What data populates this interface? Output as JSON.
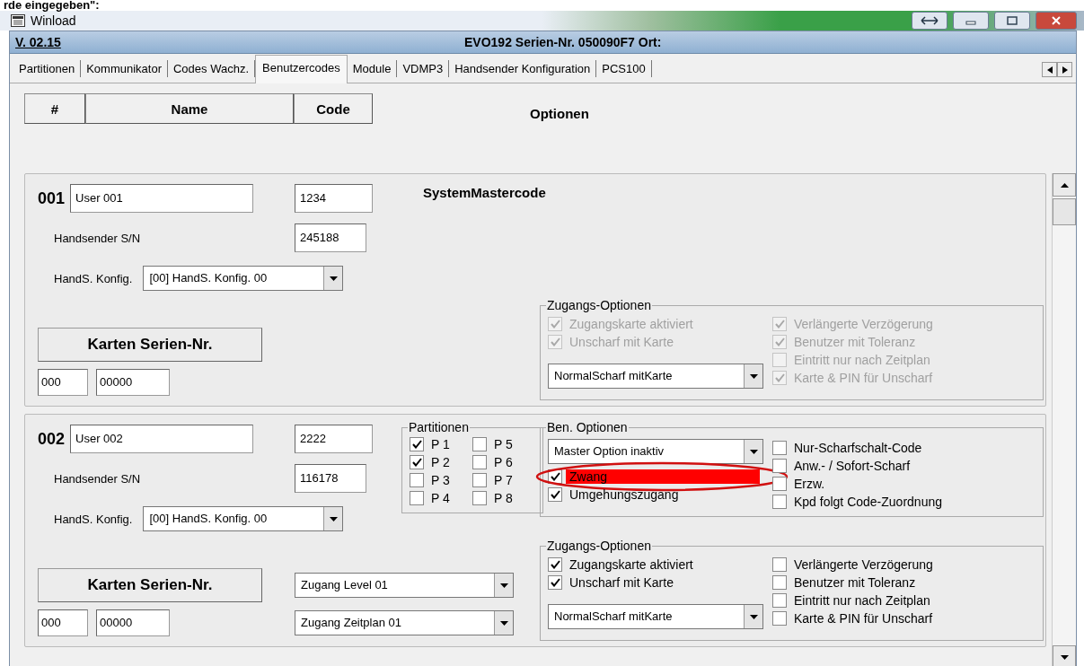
{
  "caption": "rde eingegeben\":",
  "window": {
    "title": "Winload"
  },
  "header": {
    "version": "V. 02.15",
    "info": "EVO192  Serien-Nr. 050090F7 Ort:"
  },
  "tabs": [
    {
      "label": "Partitionen",
      "selected": false
    },
    {
      "label": "Kommunikator",
      "selected": false
    },
    {
      "label": "Codes Wachz.",
      "selected": false
    },
    {
      "label": "Benutzercodes",
      "selected": true
    },
    {
      "label": "Module",
      "selected": false
    },
    {
      "label": "VDMP3",
      "selected": false
    },
    {
      "label": "Handsender Konfiguration",
      "selected": false
    },
    {
      "label": "PCS100",
      "selected": false
    }
  ],
  "columns": [
    "#",
    "Name",
    "Code",
    "Optionen"
  ],
  "users": [
    {
      "number": "001",
      "name": "User 001",
      "code": "1234",
      "master_label": "SystemMastercode",
      "handsender_label": "Handsender S/N",
      "handsender": "245188",
      "konfig_label": "HandS. Konfig.",
      "konfig": "[00] HandS. Konfig. 00",
      "card_button": "Karten Serien-Nr.",
      "card_a": "000",
      "card_b": "00000",
      "access": {
        "legend": "Zugangs-Optionen",
        "disabled": true,
        "mode": "NormalScharf mitKarte",
        "left": [
          {
            "label": "Zugangskarte aktiviert",
            "checked": true
          },
          {
            "label": "Unscharf mit Karte",
            "checked": true
          }
        ],
        "right": [
          {
            "label": "Verlängerte Verzögerung",
            "checked": true
          },
          {
            "label": "Benutzer mit Toleranz",
            "checked": true
          },
          {
            "label": "Eintritt nur nach Zeitplan",
            "checked": false
          },
          {
            "label": "Karte & PIN für Unscharf",
            "checked": true
          }
        ]
      }
    },
    {
      "number": "002",
      "name": "User 002",
      "code": "2222",
      "handsender_label": "Handsender S/N",
      "handsender": "116178",
      "konfig_label": "HandS. Konfig.",
      "konfig": "[00] HandS. Konfig. 00",
      "card_button": "Karten Serien-Nr.",
      "card_a": "000",
      "card_b": "00000",
      "partitions": {
        "legend": "Partitionen",
        "items": [
          {
            "label": "P 1",
            "checked": true
          },
          {
            "label": "P 5",
            "checked": false
          },
          {
            "label": "P 2",
            "checked": true
          },
          {
            "label": "P 6",
            "checked": false
          },
          {
            "label": "P 3",
            "checked": false
          },
          {
            "label": "P 7",
            "checked": false
          },
          {
            "label": "P 4",
            "checked": false
          },
          {
            "label": "P 8",
            "checked": false
          }
        ]
      },
      "access_level": "Zugang Level 01",
      "access_schedule": "Zugang Zeitplan 01",
      "options": {
        "legend": "Ben. Optionen",
        "master": "Master Option inaktiv",
        "left": [
          {
            "label": "Zwang",
            "checked": true,
            "highlighted": true
          },
          {
            "label": "Umgehungszugang",
            "checked": true,
            "highlighted": false
          }
        ],
        "right": [
          {
            "label": "Nur-Scharfschalt-Code",
            "checked": false
          },
          {
            "label": "Anw.- / Sofort-Scharf",
            "checked": false
          },
          {
            "label": "Erzw.",
            "checked": false
          },
          {
            "label": "Kpd folgt Code-Zuordnung",
            "checked": false
          }
        ]
      },
      "access": {
        "legend": "Zugangs-Optionen",
        "disabled": false,
        "mode": "NormalScharf mitKarte",
        "left": [
          {
            "label": "Zugangskarte aktiviert",
            "checked": true
          },
          {
            "label": "Unscharf mit Karte",
            "checked": true
          }
        ],
        "right": [
          {
            "label": "Verlängerte Verzögerung",
            "checked": false
          },
          {
            "label": "Benutzer mit Toleranz",
            "checked": false
          },
          {
            "label": "Eintritt nur nach Zeitplan",
            "checked": false
          },
          {
            "label": "Karte & PIN für Unscharf",
            "checked": false
          }
        ]
      }
    }
  ]
}
